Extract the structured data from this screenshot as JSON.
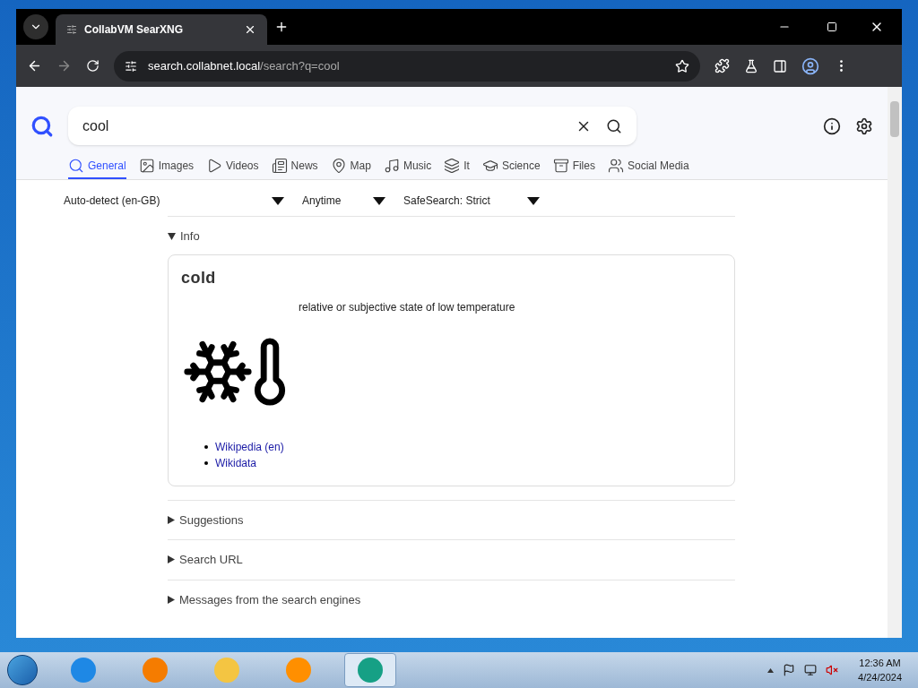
{
  "browser": {
    "tab_title": "CollabVM SearXNG",
    "url_host": "search.collabnet.local",
    "url_path": "/search?q=cool"
  },
  "search": {
    "query": "cool"
  },
  "categories": [
    {
      "label": "General",
      "kind": "search",
      "selected": true
    },
    {
      "label": "Images",
      "kind": "image",
      "selected": false
    },
    {
      "label": "Videos",
      "kind": "play",
      "selected": false
    },
    {
      "label": "News",
      "kind": "news",
      "selected": false
    },
    {
      "label": "Map",
      "kind": "pin",
      "selected": false
    },
    {
      "label": "Music",
      "kind": "music",
      "selected": false
    },
    {
      "label": "It",
      "kind": "layers",
      "selected": false
    },
    {
      "label": "Science",
      "kind": "cap",
      "selected": false
    },
    {
      "label": "Files",
      "kind": "files",
      "selected": false
    },
    {
      "label": "Social Media",
      "kind": "people",
      "selected": false
    }
  ],
  "filters": [
    {
      "label": "Auto-detect (en-GB)"
    },
    {
      "label": "Anytime"
    },
    {
      "label": "SafeSearch: Strict"
    }
  ],
  "sections": [
    {
      "title": "Info",
      "expanded": true,
      "card": {
        "title": "cold",
        "description": "relative or subjective state of low temperature",
        "links": [
          "Wikipedia (en)",
          "Wikidata"
        ]
      }
    },
    {
      "title": "Suggestions",
      "expanded": false
    },
    {
      "title": "Search URL",
      "expanded": false
    },
    {
      "title": "Messages from the search engines",
      "expanded": false
    }
  ],
  "taskbar": {
    "apps": [
      {
        "kind": "ie",
        "selected": false
      },
      {
        "kind": "firefox",
        "selected": false
      },
      {
        "kind": "explorer",
        "selected": false
      },
      {
        "kind": "media",
        "selected": false
      },
      {
        "kind": "browser",
        "selected": true
      }
    ],
    "time": "12:36 AM",
    "date": "4/24/2024"
  }
}
